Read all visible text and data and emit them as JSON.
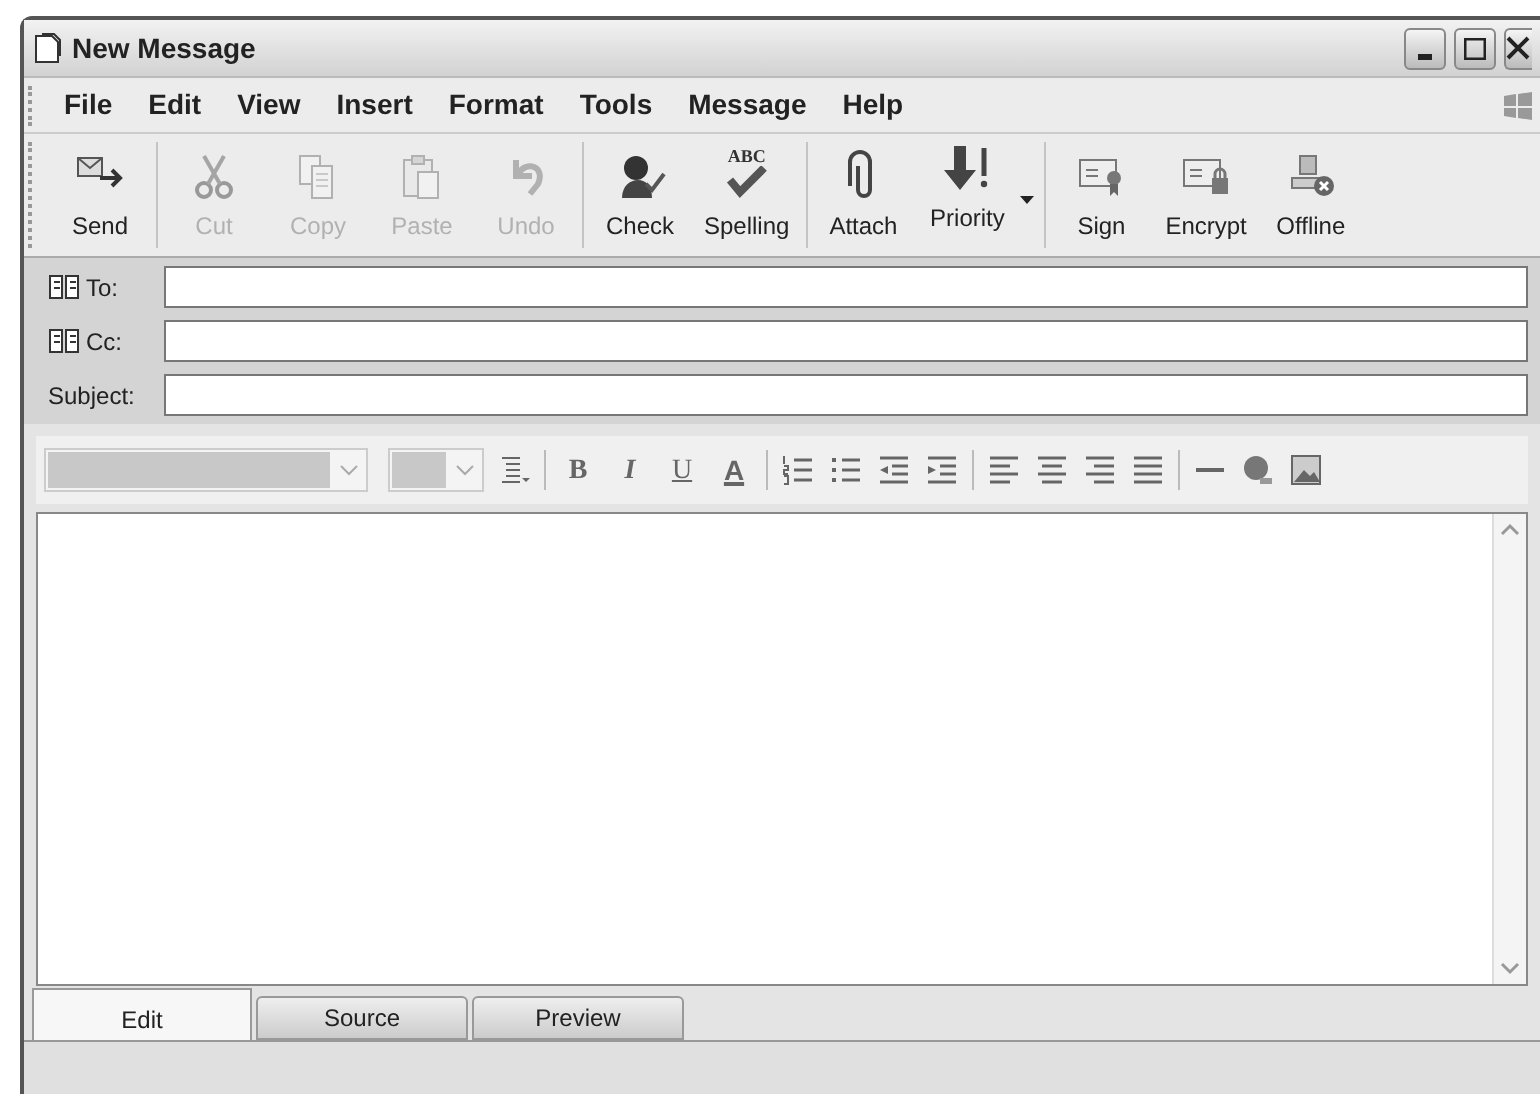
{
  "window": {
    "title": "New Message"
  },
  "menu": [
    {
      "label": "File"
    },
    {
      "label": "Edit"
    },
    {
      "label": "View"
    },
    {
      "label": "Insert"
    },
    {
      "label": "Format"
    },
    {
      "label": "Tools"
    },
    {
      "label": "Message"
    },
    {
      "label": "Help"
    }
  ],
  "toolbar": [
    {
      "label": "Send",
      "disabled": false
    },
    {
      "label": "Cut",
      "disabled": true
    },
    {
      "label": "Copy",
      "disabled": true
    },
    {
      "label": "Paste",
      "disabled": true
    },
    {
      "label": "Undo",
      "disabled": true
    },
    {
      "label": "Check",
      "disabled": false
    },
    {
      "label": "Spelling",
      "icon_text": "ABC",
      "disabled": false
    },
    {
      "label": "Attach",
      "disabled": false
    },
    {
      "label": "Priority",
      "disabled": false,
      "dropdown": true
    },
    {
      "label": "Sign",
      "disabled": false
    },
    {
      "label": "Encrypt",
      "disabled": false
    },
    {
      "label": "Offline",
      "disabled": false
    }
  ],
  "header_fields": [
    {
      "label": "To:",
      "address_book": true
    },
    {
      "label": "Cc:",
      "address_book": true
    },
    {
      "label": "Subject:",
      "address_book": false
    }
  ],
  "format_bar": {
    "buttons": [
      {
        "kind": "bold",
        "label": "B"
      },
      {
        "kind": "italic",
        "label": "I"
      },
      {
        "kind": "underline",
        "label": "U"
      },
      {
        "kind": "color",
        "label": "A"
      }
    ]
  },
  "tabs": [
    {
      "label": "Edit",
      "selected": true
    },
    {
      "label": "Source",
      "selected": false
    },
    {
      "label": "Preview",
      "selected": false
    }
  ]
}
